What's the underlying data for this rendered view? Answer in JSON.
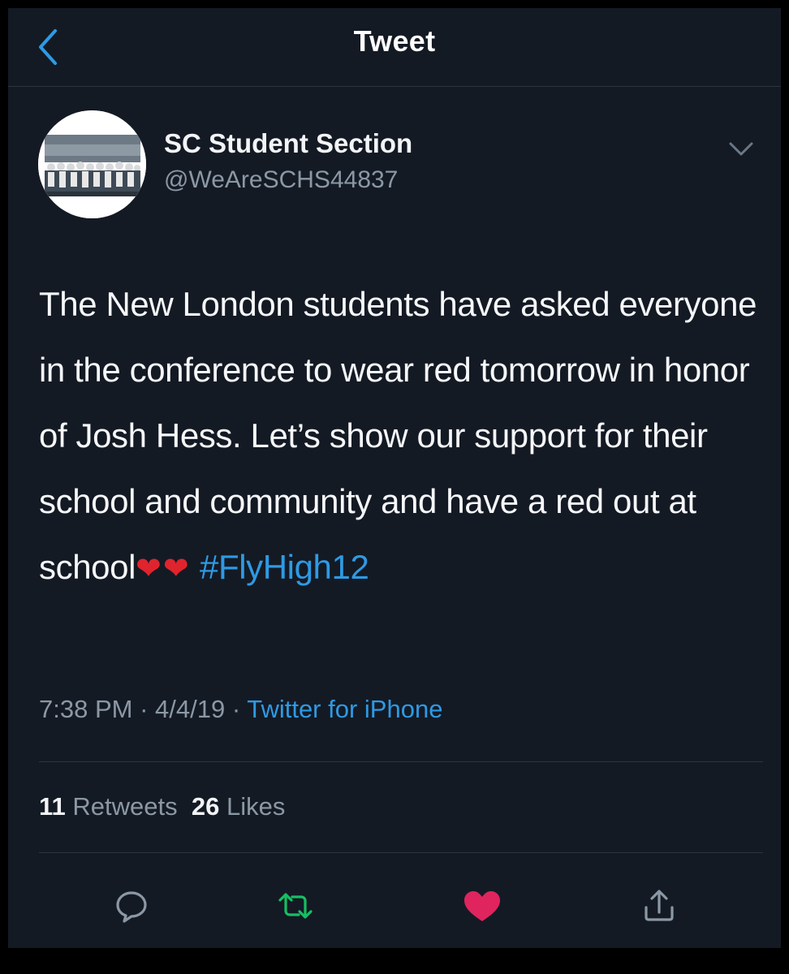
{
  "nav": {
    "title": "Tweet",
    "back_icon": "chevron-left-icon"
  },
  "author": {
    "name": "SC Student Section",
    "handle": "@WeAreSCHS44837",
    "avatar": "group-photo-avatar",
    "menu_icon": "chevron-down-icon"
  },
  "tweet": {
    "text": "The New London students have asked everyone in the conference to wear red tomorrow in honor of Josh Hess. Let’s show our support for their school and community and have a red out at school",
    "emoji": "❤❤",
    "hashtag": "#FlyHigh12"
  },
  "meta": {
    "time": "7:38 PM",
    "separator_1": " · ",
    "date": "4/4/19",
    "separator_2": " · ",
    "source": "Twitter for iPhone"
  },
  "stats": {
    "retweets_count": "11",
    "retweets_label": "Retweets",
    "likes_count": "26",
    "likes_label": "Likes"
  },
  "actions": {
    "reply_icon": "reply-icon",
    "retweet_icon": "retweet-icon",
    "like_icon": "heart-icon",
    "share_icon": "share-icon"
  },
  "colors": {
    "background": "#141a24",
    "link": "#2e9ae4",
    "secondary_text": "#8b98a5",
    "retweet_active": "#17bf63",
    "like_active": "#e0245e",
    "heart_emoji": "#e0242e"
  }
}
